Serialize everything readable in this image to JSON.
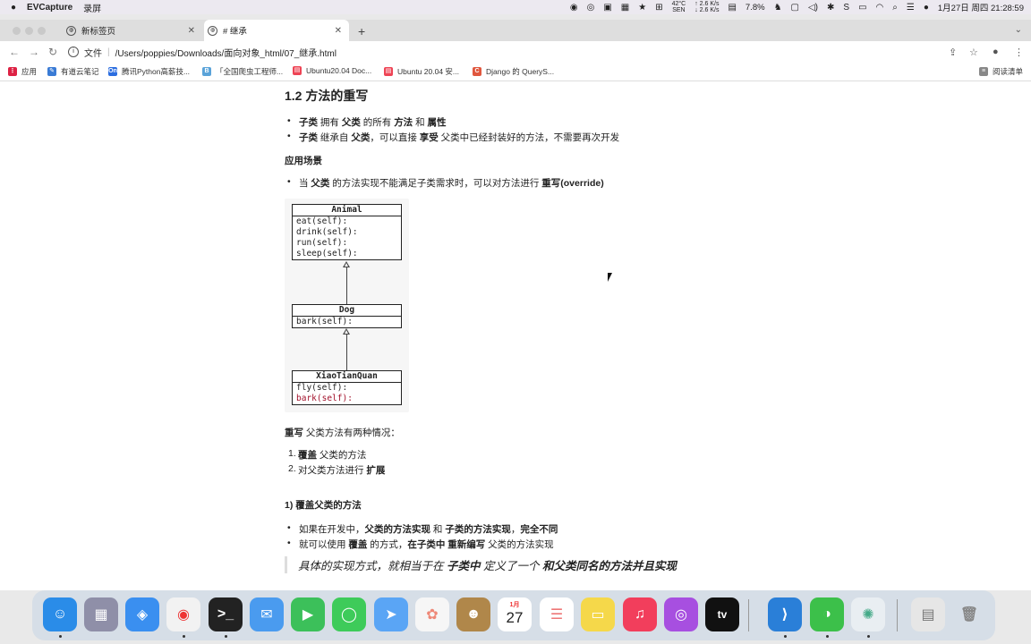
{
  "menubar": {
    "app_name": "EVCapture",
    "menu_item": "录屏",
    "temp_top": "42°C",
    "temp_bottom": "SEN",
    "net_up": "↑ 2.6 K/s",
    "net_down": "↓ 2.6 K/s",
    "cpu": "7.8%",
    "datetime": "1月27日 周四 21:28:59"
  },
  "tabs": [
    {
      "title": "新标签页"
    },
    {
      "title": "# 继承"
    }
  ],
  "address": {
    "label": "文件",
    "url": "/Users/poppies/Downloads/面向对象_html/07_继承.html"
  },
  "bookmarks": {
    "apps": "应用",
    "items": [
      "有道云笔记",
      "腾讯Python高薪技...",
      "「全国爬虫工程师...",
      "Ubuntu20.04 Doc...",
      "Ubuntu 20.04 安...",
      "Django 的 QueryS..."
    ],
    "reading_list": "阅读清单"
  },
  "doc": {
    "heading": "1.2 方法的重写",
    "bullets1": [
      {
        "a": "子类",
        "b": " 拥有 ",
        "c": "父类",
        "d": " 的所有 ",
        "e": "方法",
        "f": " 和 ",
        "g": "属性"
      },
      {
        "a": "子类",
        "b": " 继承自 ",
        "c": "父类",
        "d": "，可以直接 ",
        "e": "享受",
        "f": " 父类中已经封装好的方法，不需要再次开发",
        "g": ""
      }
    ],
    "scene_title": "应用场景",
    "scene_bullet": {
      "a": "当 ",
      "b": "父类",
      "c": " 的方法实现不能满足子类需求时，可以对方法进行 ",
      "d": "重写(override)"
    },
    "uml": {
      "animal": {
        "name": "Animal",
        "methods": [
          "eat(self):",
          "drink(self):",
          "run(self):",
          "sleep(self):"
        ]
      },
      "dog": {
        "name": "Dog",
        "methods": [
          "bark(self):"
        ]
      },
      "xtq": {
        "name": "XiaoTianQuan",
        "methods": [
          "fly(self):",
          "bark(self):"
        ]
      }
    },
    "override_intro": {
      "a": "重写",
      "b": " 父类方法有两种情况："
    },
    "ordered": [
      {
        "n": "1.",
        "a": "覆盖",
        "b": " 父类的方法"
      },
      {
        "n": "2.",
        "a": "对父类方法进行 ",
        "b": "扩展"
      }
    ],
    "sub1": "1) 覆盖父类的方法",
    "bullets2": [
      {
        "a": "如果在开发中，",
        "b": "父类的方法实现",
        "c": " 和 ",
        "d": "子类的方法实现",
        "e": "，",
        "f": "完全不同"
      },
      {
        "a": "就可以使用 ",
        "b": "覆盖",
        "c": " 的方式，",
        "d": "在子类中 重新编写",
        "e": " 父类的方法实现",
        "f": ""
      }
    ],
    "quote": {
      "a": "具体的实现方式，就相当于在 ",
      "b": "子类中",
      "c": " 定义了一个 ",
      "d": "和父类同名的方法并且实现"
    }
  },
  "dock": {
    "calendar_month": "1月",
    "calendar_day": "27",
    "tv_label": "tv"
  }
}
